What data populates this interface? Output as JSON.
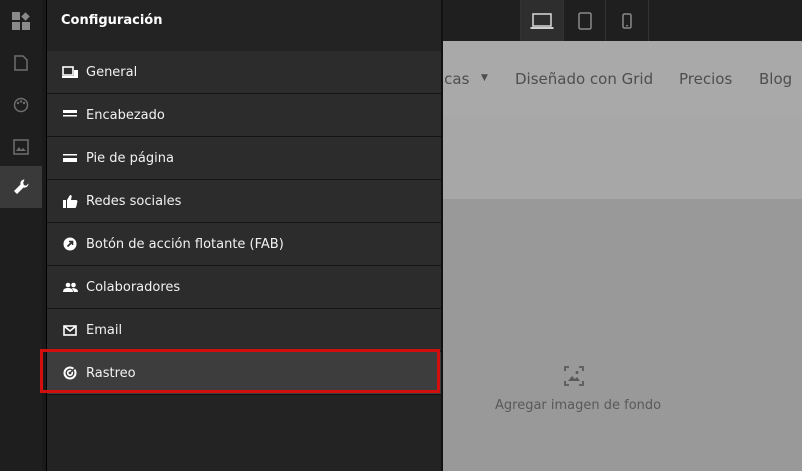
{
  "rail": {
    "items": [
      {
        "name": "blocks-icon",
        "active": false
      },
      {
        "name": "page-icon",
        "active": false
      },
      {
        "name": "palette-icon",
        "active": false
      },
      {
        "name": "image-icon",
        "active": false
      },
      {
        "name": "wrench-icon",
        "active": true
      }
    ]
  },
  "panel": {
    "title": "Configuración",
    "items": [
      {
        "label": "General",
        "icon": "devices-icon"
      },
      {
        "label": "Encabezado",
        "icon": "header-icon"
      },
      {
        "label": "Pie de página",
        "icon": "footer-icon"
      },
      {
        "label": "Redes sociales",
        "icon": "thumbs-up-icon"
      },
      {
        "label": "Botón de acción flotante (FAB)",
        "icon": "fab-icon"
      },
      {
        "label": "Colaboradores",
        "icon": "people-icon"
      },
      {
        "label": "Email",
        "icon": "mail-icon"
      },
      {
        "label": "Rastreo",
        "icon": "tracking-icon"
      }
    ]
  },
  "devices": [
    "laptop-icon",
    "tablet-icon",
    "phone-icon"
  ],
  "preview": {
    "nav_partial": "icas",
    "nav_links": [
      "Diseñado con Grid",
      "Precios",
      "Blog"
    ],
    "background_label": "Agregar imagen de fondo"
  },
  "colors": {
    "highlight": "#d10f0f",
    "panel_bg": "#232323",
    "item_bg": "#2c2c2c"
  }
}
